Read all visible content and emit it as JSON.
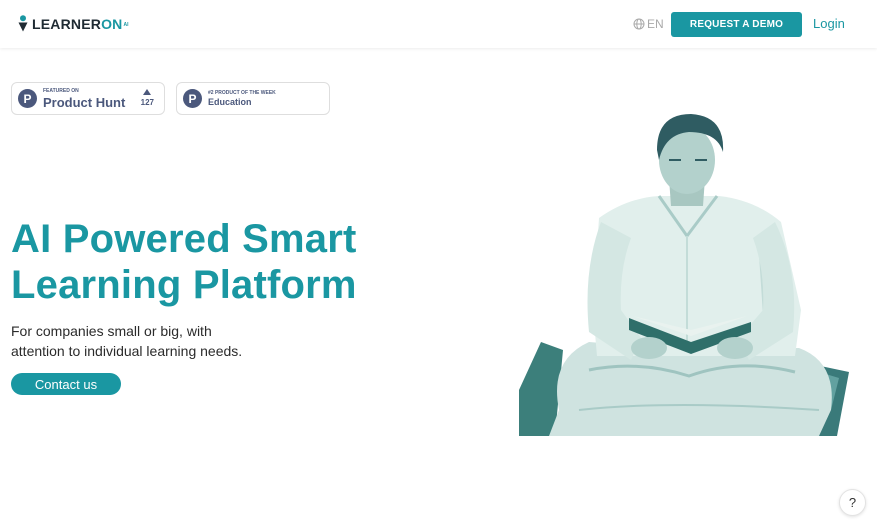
{
  "header": {
    "logo_main": "LEARNER",
    "logo_accent": "ON",
    "logo_sub": "AI",
    "language": "EN",
    "demo_button": "REQUEST A DEMO",
    "login": "Login"
  },
  "badges": {
    "product_hunt": {
      "small": "FEATURED ON",
      "title": "Product Hunt",
      "votes": "127",
      "logo_letter": "P"
    },
    "product_week": {
      "small": "#2 PRODUCT OF THE WEEK",
      "title": "Education",
      "logo_letter": "P"
    }
  },
  "hero": {
    "title_line1": "AI Powered Smart",
    "title_line2": "Learning Platform",
    "subtitle_line1": "For companies small or big, with",
    "subtitle_line2": "attention to individual learning needs.",
    "cta": "Contact us"
  },
  "help_button": "?",
  "colors": {
    "brand": "#1a97a2",
    "product_hunt": "#4b587c",
    "dark_text": "#2b2b2b"
  },
  "icons": [
    "learneron-logo-icon",
    "globe-icon",
    "product-hunt-icon",
    "upvote-icon",
    "help-icon"
  ]
}
